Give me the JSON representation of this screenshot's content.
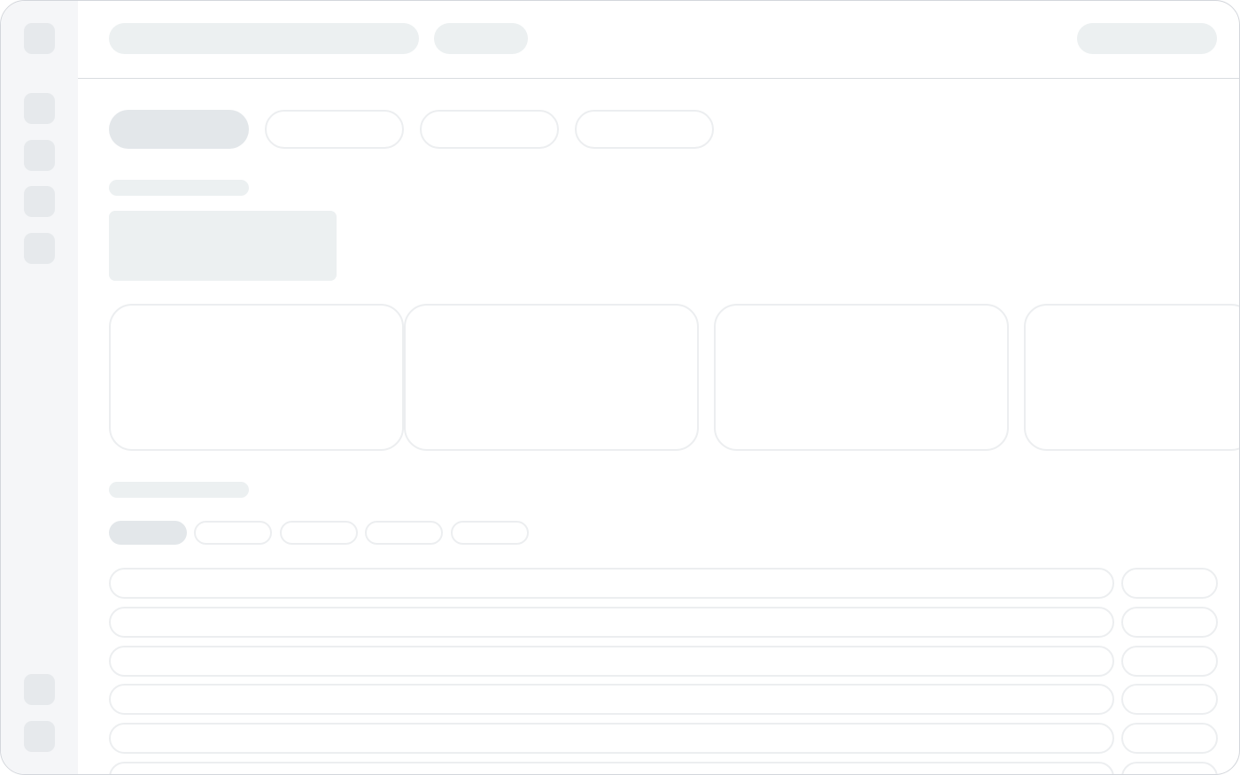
{
  "sidebar": {
    "top_items": [
      "sidebar-item-1",
      "sidebar-item-2",
      "sidebar-item-3",
      "sidebar-item-4",
      "sidebar-item-5"
    ],
    "bottom_items": [
      "sidebar-item-6",
      "sidebar-item-7"
    ]
  },
  "header": {
    "search_placeholder": "",
    "filter_label": "",
    "account_label": ""
  },
  "tabs": [
    "",
    "",
    "",
    ""
  ],
  "section_one": {
    "title": "",
    "summary": ""
  },
  "cards": [
    "",
    "",
    "",
    ""
  ],
  "section_two": {
    "title": ""
  },
  "chips": [
    "",
    "",
    "",
    "",
    ""
  ],
  "rows": [
    {
      "label": "",
      "action": ""
    },
    {
      "label": "",
      "action": ""
    },
    {
      "label": "",
      "action": ""
    },
    {
      "label": "",
      "action": ""
    },
    {
      "label": "",
      "action": ""
    },
    {
      "label": "",
      "action": ""
    }
  ],
  "colors": {
    "sidebar_bg": "#f5f6f8",
    "skeleton_fill": "#ecf0f1",
    "skeleton_outline": "#eceef0",
    "frame_border": "#d3d6db"
  }
}
